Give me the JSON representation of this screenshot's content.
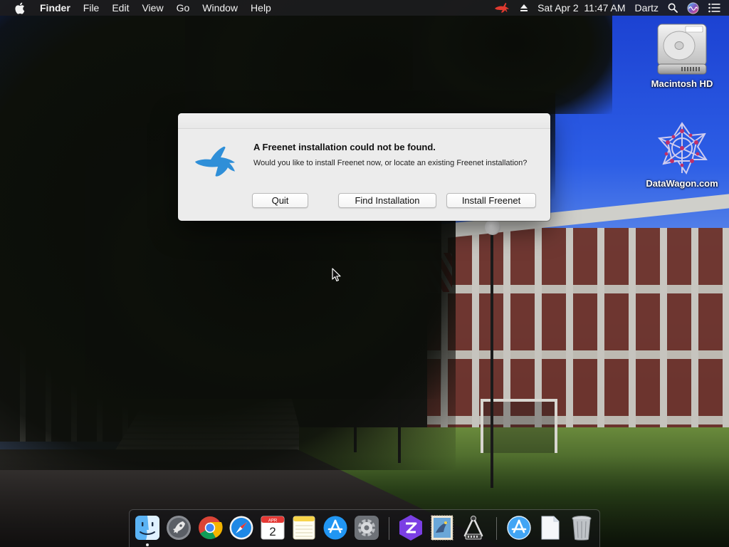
{
  "menubar": {
    "apple_icon": "apple-logo-icon",
    "app_name": "Finder",
    "menus": [
      "File",
      "Edit",
      "View",
      "Go",
      "Window",
      "Help"
    ],
    "status": {
      "freenet_icon": "freenet-rabbit-icon",
      "eject_icon": "eject-icon",
      "datetime": "Sat Apr 2  11:47 AM",
      "user": "Dartz",
      "search_icon": "spotlight-search-icon",
      "siri_icon": "siri-icon",
      "notifications_icon": "notification-center-icon"
    }
  },
  "desktop": {
    "icons": [
      {
        "label": "Macintosh HD",
        "icon": "hard-drive-icon"
      },
      {
        "label": "DataWagon.com",
        "icon": "datawagon-logo-icon"
      }
    ]
  },
  "dialog": {
    "icon": "freenet-rabbit-icon",
    "title": "A Freenet installation could not be found.",
    "message": "Would you like to install Freenet now, or locate an existing Freenet installation?",
    "buttons": {
      "quit": "Quit",
      "find": "Find Installation",
      "install": "Install Freenet"
    }
  },
  "dock": {
    "items": [
      "finder-icon",
      "launchpad-icon",
      "chrome-icon",
      "safari-icon",
      "calendar-icon",
      "notes-icon",
      "app-store-icon",
      "system-preferences-icon",
      "zeplin-icon",
      "mail-stamp-icon",
      "xcode-instruments-icon",
      "app-store-downloads-icon",
      "documents-folder-icon",
      "trash-icon"
    ],
    "calendar": {
      "month": "APR",
      "day": "2"
    }
  },
  "colors": {
    "menubar_bg": "#1c1c1e",
    "dialog_bg": "#ececec",
    "freenet_blue": "#2f8fd8",
    "freenet_red": "#e03a2f"
  }
}
